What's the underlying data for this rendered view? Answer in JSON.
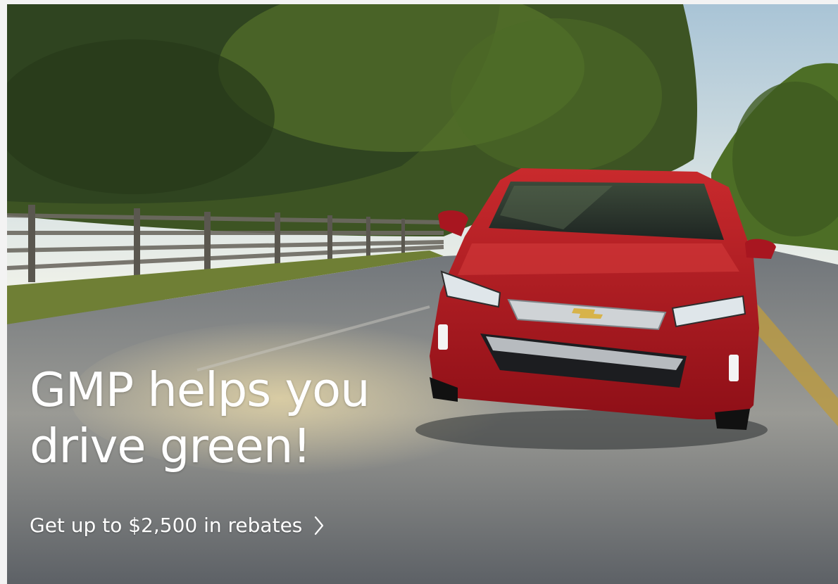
{
  "hero": {
    "headline_line1": "GMP helps you",
    "headline_line2": "drive green!",
    "cta_label": "Get up to $2,500 in rebates",
    "cta_icon": "chevron-right-icon",
    "image": "red-car-on-tree-lined-road"
  },
  "colors": {
    "text": "#ffffff",
    "car_red": "#b0141e",
    "foliage": "#3f5a22",
    "road": "#8a8c8f"
  }
}
